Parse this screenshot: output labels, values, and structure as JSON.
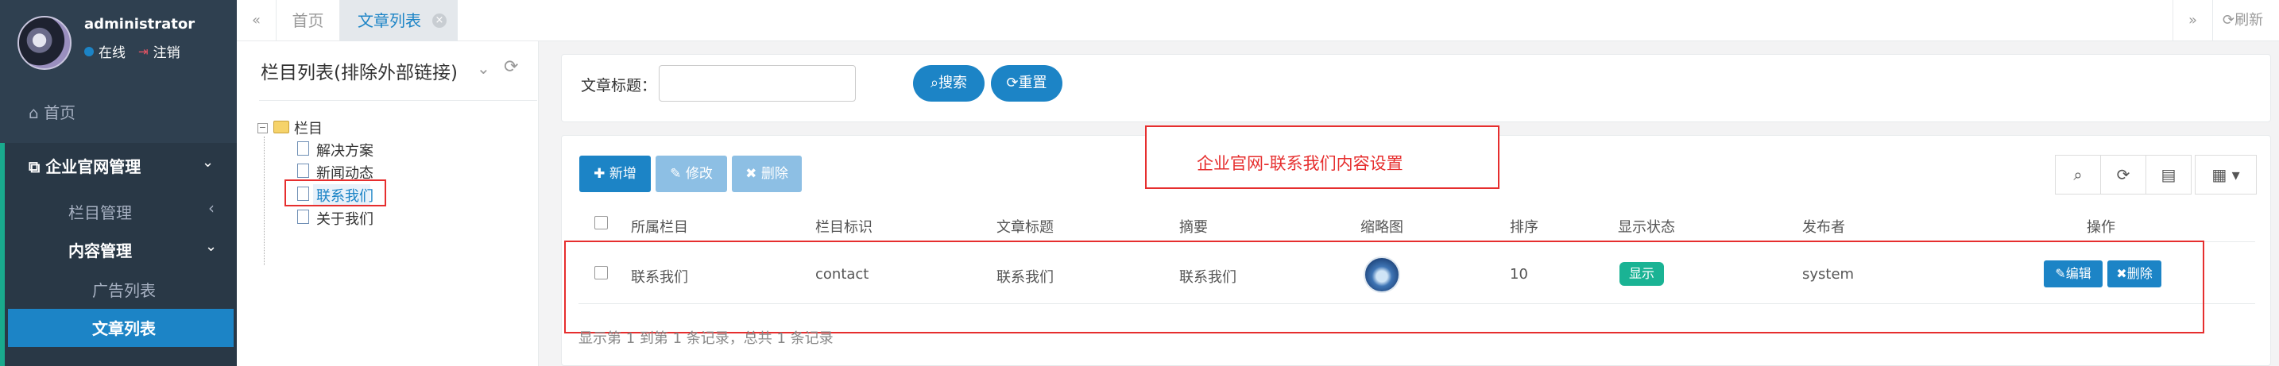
{
  "user": {
    "name": "administrator",
    "status": "在线",
    "logout": "注销"
  },
  "nav": {
    "home": "首页",
    "group": "企业官网管理",
    "column_mgmt": "栏目管理",
    "content_mgmt": "内容管理",
    "ad_list": "广告列表",
    "article_list": "文章列表"
  },
  "tabs": {
    "home": "首页",
    "current": "文章列表",
    "refresh": "刷新"
  },
  "tree": {
    "title": "栏目列表(排除外部链接)",
    "root": "栏目",
    "items": [
      "解决方案",
      "新闻动态",
      "联系我们",
      "关于我们"
    ]
  },
  "search": {
    "label": "文章标题：",
    "value": "",
    "search_btn": "搜索",
    "reset_btn": "重置"
  },
  "toolbar": {
    "add": "新增",
    "edit": "修改",
    "delete": "删除"
  },
  "annotation": "企业官网-联系我们内容设置",
  "table": {
    "headers": [
      "所属栏目",
      "栏目标识",
      "文章标题",
      "摘要",
      "缩略图",
      "排序",
      "显示状态",
      "发布者",
      "操作"
    ],
    "rows": [
      {
        "column": "联系我们",
        "ident": "contact",
        "title": "联系我们",
        "summary": "联系我们",
        "sort": "10",
        "status": "显示",
        "publisher": "system",
        "edit": "编辑",
        "delete": "删除"
      }
    ],
    "footer": "显示第 1 到第 1 条记录，总共 1 条记录"
  },
  "colors": {
    "primary": "#1c84c6",
    "success": "#1ab394",
    "sidebar": "#2f4050",
    "annotation": "#e62e2e"
  }
}
